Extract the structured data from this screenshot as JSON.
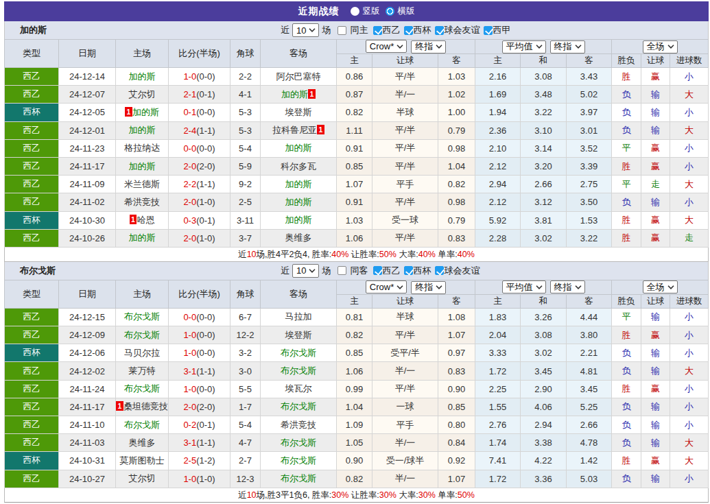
{
  "title_bar": {
    "title": "近期战绩",
    "layout_options": [
      {
        "label": "竖版",
        "selected": false
      },
      {
        "label": "横版",
        "selected": true
      }
    ]
  },
  "table_header": {
    "left_columns": [
      "类型",
      "日期",
      "主场",
      "比分(半场)",
      "角球",
      "客场"
    ],
    "odds_group_selects": [
      "Crow*",
      "终指"
    ],
    "odds_sub_columns": [
      "主",
      "让球",
      "客"
    ],
    "avg_group_selects": [
      "平均值",
      "终指"
    ],
    "avg_sub_columns": [
      "主",
      "和",
      "客"
    ],
    "result_group_select": "全场",
    "result_sub_columns": [
      "胜负",
      "让球",
      "进球数"
    ]
  },
  "colors": {
    "titlebar_bg": "#4B3D9C",
    "league_badge": "#4E9908",
    "cup_badge": "#12776C",
    "subject_team": "#028102",
    "score_red": "#DD0000",
    "win_red": "#C00000",
    "draw_green": "#12820D",
    "lose_blue": "#2B2BAE",
    "checkbox_blue": "#1E9BF0"
  },
  "sections": [
    {
      "team": "加的斯",
      "filter": {
        "prefix": "近",
        "match_count": "10",
        "suffix": "场",
        "same_side_label": "同主",
        "same_side_checked": false,
        "competitions": [
          {
            "label": "西乙",
            "checked": true
          },
          {
            "label": "西杯",
            "checked": true
          },
          {
            "label": "球会友谊",
            "checked": true
          },
          {
            "label": "西甲",
            "checked": true
          }
        ]
      },
      "rows": [
        {
          "comp": "西乙",
          "type": "league",
          "date": "24-12-14",
          "home": {
            "name": "加的斯",
            "subject": true
          },
          "score": "1-0",
          "half": "(0-0)",
          "corners": "2-2",
          "away": {
            "name": "阿尔巴塞特",
            "subject": false
          },
          "odds": [
            "0.86",
            "平/半",
            "1.03"
          ],
          "avg": [
            "2.16",
            "3.08",
            "3.43"
          ],
          "outcome": {
            "text": "胜",
            "c": "r"
          },
          "handicap": {
            "text": "赢",
            "c": "r"
          },
          "goals": {
            "text": "小",
            "c": "b"
          }
        },
        {
          "comp": "西乙",
          "type": "league",
          "date": "24-12-07",
          "home": {
            "name": "艾尔切",
            "subject": false
          },
          "score": "2-1",
          "half": "(0-1)",
          "corners": "4-1",
          "away": {
            "name": "加的斯",
            "subject": true,
            "badge": "1",
            "badge_pos": "after"
          },
          "odds": [
            "0.87",
            "半/一",
            "1.02"
          ],
          "avg": [
            "1.69",
            "3.48",
            "5.02"
          ],
          "outcome": {
            "text": "负",
            "c": "b"
          },
          "handicap": {
            "text": "输",
            "c": "b"
          },
          "goals": {
            "text": "大",
            "c": "r"
          }
        },
        {
          "comp": "西杯",
          "type": "cup",
          "date": "24-12-05",
          "home": {
            "name": "加的斯",
            "subject": true,
            "badge": "1",
            "badge_pos": "before"
          },
          "score": "0-1",
          "half": "(0-0)",
          "corners": "5-3",
          "away": {
            "name": "埃登斯",
            "subject": false
          },
          "odds": [
            "0.82",
            "半球",
            "1.00"
          ],
          "avg": [
            "1.94",
            "3.22",
            "3.97"
          ],
          "outcome": {
            "text": "负",
            "c": "b"
          },
          "handicap": {
            "text": "输",
            "c": "b"
          },
          "goals": {
            "text": "小",
            "c": "b"
          }
        },
        {
          "comp": "西乙",
          "type": "league",
          "date": "24-12-01",
          "home": {
            "name": "加的斯",
            "subject": true
          },
          "score": "2-4",
          "half": "(1-1)",
          "corners": "5-3",
          "away": {
            "name": "拉科鲁尼亚",
            "subject": false,
            "badge": "1",
            "badge_pos": "after"
          },
          "odds": [
            "1.11",
            "平/半",
            "0.79"
          ],
          "avg": [
            "2.36",
            "3.10",
            "3.01"
          ],
          "outcome": {
            "text": "负",
            "c": "b"
          },
          "handicap": {
            "text": "输",
            "c": "b"
          },
          "goals": {
            "text": "大",
            "c": "r"
          }
        },
        {
          "comp": "西乙",
          "type": "league",
          "date": "24-11-23",
          "home": {
            "name": "格拉纳达",
            "subject": false
          },
          "score": "0-0",
          "half": "(0-0)",
          "corners": "5-4",
          "away": {
            "name": "加的斯",
            "subject": true
          },
          "odds": [
            "0.91",
            "平/半",
            "0.98"
          ],
          "avg": [
            "2.10",
            "3.14",
            "3.52"
          ],
          "outcome": {
            "text": "平",
            "c": "g"
          },
          "handicap": {
            "text": "赢",
            "c": "r"
          },
          "goals": {
            "text": "小",
            "c": "b"
          }
        },
        {
          "comp": "西乙",
          "type": "league",
          "date": "24-11-17",
          "home": {
            "name": "加的斯",
            "subject": true
          },
          "score": "2-0",
          "half": "(2-0)",
          "corners": "5-9",
          "away": {
            "name": "科尔多瓦",
            "subject": false
          },
          "odds": [
            "0.85",
            "平/半",
            "1.04"
          ],
          "avg": [
            "2.12",
            "3.20",
            "3.39"
          ],
          "outcome": {
            "text": "胜",
            "c": "r"
          },
          "handicap": {
            "text": "赢",
            "c": "r"
          },
          "goals": {
            "text": "小",
            "c": "b"
          }
        },
        {
          "comp": "西乙",
          "type": "league",
          "date": "24-11-09",
          "home": {
            "name": "米兰德斯",
            "subject": false
          },
          "score": "2-2",
          "half": "(1-1)",
          "corners": "9-2",
          "away": {
            "name": "加的斯",
            "subject": true
          },
          "odds": [
            "1.07",
            "平手",
            "0.82"
          ],
          "avg": [
            "2.94",
            "2.66",
            "2.75"
          ],
          "outcome": {
            "text": "平",
            "c": "g"
          },
          "handicap": {
            "text": "走",
            "c": "g"
          },
          "goals": {
            "text": "大",
            "c": "r"
          }
        },
        {
          "comp": "西乙",
          "type": "league",
          "date": "24-11-02",
          "home": {
            "name": "希洪竞技",
            "subject": false
          },
          "score": "2-0",
          "half": "(1-0)",
          "corners": "2-5",
          "away": {
            "name": "加的斯",
            "subject": true
          },
          "odds": [
            "0.91",
            "平/半",
            "0.98"
          ],
          "avg": [
            "2.12",
            "3.12",
            "3.50"
          ],
          "outcome": {
            "text": "负",
            "c": "b"
          },
          "handicap": {
            "text": "输",
            "c": "b"
          },
          "goals": {
            "text": "小",
            "c": "b"
          }
        },
        {
          "comp": "西杯",
          "type": "cup",
          "date": "24-10-30",
          "home": {
            "name": "哈恩",
            "subject": false,
            "badge": "1",
            "badge_pos": "before"
          },
          "score": "0-3",
          "half": "(0-1)",
          "corners": "3-11",
          "away": {
            "name": "加的斯",
            "subject": true
          },
          "odds": [
            "1.03",
            "受一球",
            "0.79"
          ],
          "avg": [
            "5.92",
            "3.81",
            "1.53"
          ],
          "outcome": {
            "text": "胜",
            "c": "r"
          },
          "handicap": {
            "text": "赢",
            "c": "r"
          },
          "goals": {
            "text": "大",
            "c": "r"
          }
        },
        {
          "comp": "西乙",
          "type": "league",
          "date": "24-10-26",
          "home": {
            "name": "加的斯",
            "subject": true
          },
          "score": "2-0",
          "half": "(1-0)",
          "corners": "3-7",
          "away": {
            "name": "奥维多",
            "subject": false
          },
          "odds": [
            "1.06",
            "平/半",
            "0.83"
          ],
          "avg": [
            "2.28",
            "3.02",
            "3.22"
          ],
          "outcome": {
            "text": "胜",
            "c": "r"
          },
          "handicap": {
            "text": "赢",
            "c": "r"
          },
          "goals": {
            "text": "走",
            "c": "g"
          }
        }
      ],
      "summary": [
        {
          "text": "近",
          "red": false
        },
        {
          "text": "10",
          "red": true
        },
        {
          "text": "场,胜4平2负4, 胜率:",
          "red": false
        },
        {
          "text": "40%",
          "red": true
        },
        {
          "text": " 让胜率:",
          "red": false
        },
        {
          "text": "50%",
          "red": true
        },
        {
          "text": " 大率:",
          "red": false
        },
        {
          "text": "40%",
          "red": true
        },
        {
          "text": " 单率:",
          "red": false
        },
        {
          "text": "40%",
          "red": true
        }
      ]
    },
    {
      "team": "布尔戈斯",
      "filter": {
        "prefix": "近",
        "match_count": "10",
        "suffix": "场",
        "same_side_label": "同客",
        "same_side_checked": false,
        "competitions": [
          {
            "label": "西乙",
            "checked": true
          },
          {
            "label": "西杯",
            "checked": true
          },
          {
            "label": "球会友谊",
            "checked": true
          }
        ]
      },
      "rows": [
        {
          "comp": "西乙",
          "type": "league",
          "date": "24-12-15",
          "home": {
            "name": "布尔戈斯",
            "subject": true
          },
          "score": "0-0",
          "half": "(0-0)",
          "corners": "6-7",
          "away": {
            "name": "马拉加",
            "subject": false
          },
          "odds": [
            "0.81",
            "半球",
            "1.08"
          ],
          "avg": [
            "1.83",
            "3.26",
            "4.44"
          ],
          "outcome": {
            "text": "平",
            "c": "g"
          },
          "handicap": {
            "text": "输",
            "c": "b"
          },
          "goals": {
            "text": "小",
            "c": "b"
          }
        },
        {
          "comp": "西乙",
          "type": "league",
          "date": "24-12-09",
          "home": {
            "name": "布尔戈斯",
            "subject": true
          },
          "score": "1-0",
          "half": "(0-0)",
          "corners": "12-2",
          "away": {
            "name": "埃登斯",
            "subject": false
          },
          "odds": [
            "0.82",
            "平/半",
            "1.07"
          ],
          "avg": [
            "2.04",
            "3.08",
            "3.80"
          ],
          "outcome": {
            "text": "胜",
            "c": "r"
          },
          "handicap": {
            "text": "赢",
            "c": "r"
          },
          "goals": {
            "text": "小",
            "c": "b"
          }
        },
        {
          "comp": "西杯",
          "type": "cup",
          "date": "24-12-06",
          "home": {
            "name": "马贝尔拉",
            "subject": false
          },
          "score": "1-0",
          "half": "(0-0)",
          "corners": "3-2",
          "away": {
            "name": "布尔戈斯",
            "subject": true
          },
          "odds": [
            "0.85",
            "受平/半",
            "0.97"
          ],
          "avg": [
            "3.33",
            "3.02",
            "2.21"
          ],
          "outcome": {
            "text": "负",
            "c": "b"
          },
          "handicap": {
            "text": "输",
            "c": "b"
          },
          "goals": {
            "text": "小",
            "c": "b"
          }
        },
        {
          "comp": "西乙",
          "type": "league",
          "date": "24-12-02",
          "home": {
            "name": "莱万特",
            "subject": false
          },
          "score": "3-1",
          "half": "(1-1)",
          "corners": "3-0",
          "away": {
            "name": "布尔戈斯",
            "subject": true
          },
          "odds": [
            "1.06",
            "半/一",
            "0.83"
          ],
          "avg": [
            "1.72",
            "3.45",
            "4.81"
          ],
          "outcome": {
            "text": "负",
            "c": "b"
          },
          "handicap": {
            "text": "输",
            "c": "b"
          },
          "goals": {
            "text": "大",
            "c": "r"
          }
        },
        {
          "comp": "西乙",
          "type": "league",
          "date": "24-11-24",
          "home": {
            "name": "布尔戈斯",
            "subject": true
          },
          "score": "1-0",
          "half": "(0-0)",
          "corners": "5-5",
          "away": {
            "name": "埃瓦尔",
            "subject": false
          },
          "odds": [
            "0.99",
            "平/半",
            "0.90"
          ],
          "avg": [
            "2.25",
            "2.90",
            "3.45"
          ],
          "outcome": {
            "text": "胜",
            "c": "r"
          },
          "handicap": {
            "text": "赢",
            "c": "r"
          },
          "goals": {
            "text": "小",
            "c": "b"
          }
        },
        {
          "comp": "西乙",
          "type": "league",
          "date": "24-11-17",
          "home": {
            "name": "桑坦德竞技",
            "subject": false,
            "badge": "1",
            "badge_pos": "before"
          },
          "score": "2-0",
          "half": "(2-0)",
          "corners": "1-7",
          "away": {
            "name": "布尔戈斯",
            "subject": true
          },
          "odds": [
            "1.04",
            "一球",
            "0.85"
          ],
          "avg": [
            "1.55",
            "4.06",
            "5.25"
          ],
          "outcome": {
            "text": "负",
            "c": "b"
          },
          "handicap": {
            "text": "输",
            "c": "b"
          },
          "goals": {
            "text": "小",
            "c": "b"
          }
        },
        {
          "comp": "西乙",
          "type": "league",
          "date": "24-11-10",
          "home": {
            "name": "布尔戈斯",
            "subject": true
          },
          "score": "0-2",
          "half": "(0-1)",
          "corners": "5-4",
          "away": {
            "name": "希洪竞技",
            "subject": false
          },
          "odds": [
            "1.09",
            "平手",
            "0.80"
          ],
          "avg": [
            "2.76",
            "2.94",
            "2.66"
          ],
          "outcome": {
            "text": "负",
            "c": "b"
          },
          "handicap": {
            "text": "输",
            "c": "b"
          },
          "goals": {
            "text": "小",
            "c": "b"
          }
        },
        {
          "comp": "西乙",
          "type": "league",
          "date": "24-11-03",
          "home": {
            "name": "奥维多",
            "subject": false
          },
          "score": "3-1",
          "half": "(1-1)",
          "corners": "4-7",
          "away": {
            "name": "布尔戈斯",
            "subject": true
          },
          "odds": [
            "1.05",
            "半/一",
            "0.84"
          ],
          "avg": [
            "1.74",
            "3.38",
            "4.78"
          ],
          "outcome": {
            "text": "负",
            "c": "b"
          },
          "handicap": {
            "text": "输",
            "c": "b"
          },
          "goals": {
            "text": "大",
            "c": "r"
          }
        },
        {
          "comp": "西杯",
          "type": "cup",
          "date": "24-10-31",
          "home": {
            "name": "莫斯图勒士",
            "subject": false
          },
          "score": "2-5",
          "half": "(1-2)",
          "corners": "2-7",
          "away": {
            "name": "布尔戈斯",
            "subject": true
          },
          "odds": [
            "0.90",
            "受一/球半",
            "0.92"
          ],
          "avg": [
            "7.41",
            "4.22",
            "1.42"
          ],
          "outcome": {
            "text": "胜",
            "c": "r"
          },
          "handicap": {
            "text": "赢",
            "c": "r"
          },
          "goals": {
            "text": "大",
            "c": "r"
          }
        },
        {
          "comp": "西乙",
          "type": "league",
          "date": "24-10-27",
          "home": {
            "name": "艾尔切",
            "subject": false
          },
          "score": "1-0",
          "half": "(1-0)",
          "corners": "12-3",
          "away": {
            "name": "布尔戈斯",
            "subject": true
          },
          "odds": [
            "0.82",
            "半/一",
            "1.07"
          ],
          "avg": [
            "1.72",
            "3.36",
            "5.03"
          ],
          "outcome": {
            "text": "负",
            "c": "b"
          },
          "handicap": {
            "text": "输",
            "c": "b"
          },
          "goals": {
            "text": "小",
            "c": "b"
          }
        }
      ],
      "summary": [
        {
          "text": "近",
          "red": false
        },
        {
          "text": "10",
          "red": true
        },
        {
          "text": "场,胜3平1负6, 胜率:",
          "red": false
        },
        {
          "text": "30%",
          "red": true
        },
        {
          "text": " 让胜率:",
          "red": false
        },
        {
          "text": "30%",
          "red": true
        },
        {
          "text": " 大率:",
          "red": false
        },
        {
          "text": "30%",
          "red": true
        },
        {
          "text": " 单率:",
          "red": false
        },
        {
          "text": "50%",
          "red": true
        }
      ]
    }
  ]
}
